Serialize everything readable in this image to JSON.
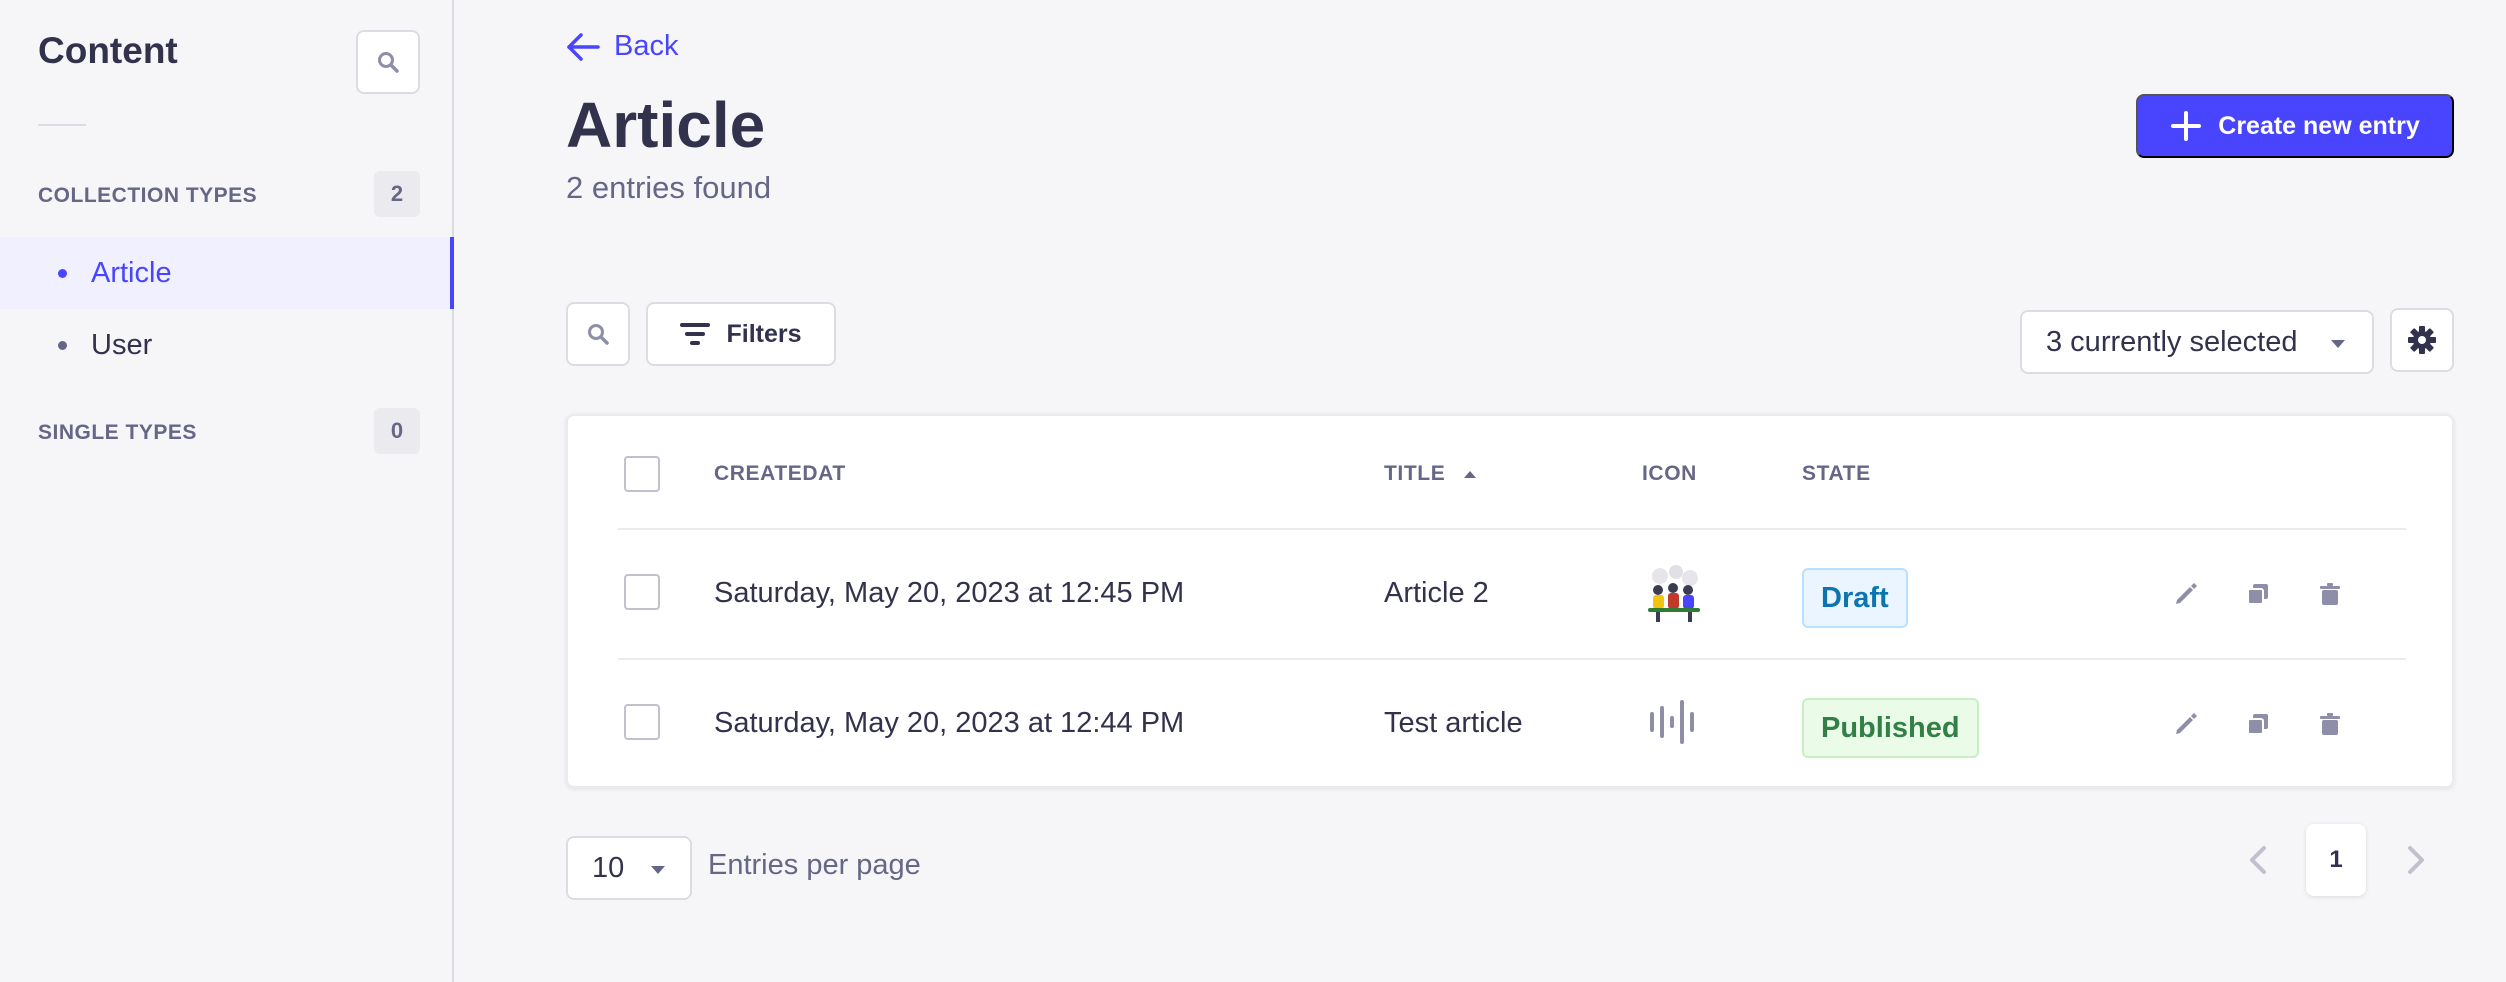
{
  "sidebar": {
    "title": "Content",
    "sections": [
      {
        "label": "COLLECTION TYPES",
        "count": "2"
      },
      {
        "label": "SINGLE TYPES",
        "count": "0"
      }
    ],
    "items": [
      {
        "label": "Article",
        "active": true
      },
      {
        "label": "User",
        "active": false
      }
    ]
  },
  "header": {
    "back_label": "Back",
    "title": "Article",
    "subtitle": "2 entries found",
    "create_label": "Create new entry"
  },
  "toolbar": {
    "filters_label": "Filters",
    "columns_selected": "3 currently selected"
  },
  "table": {
    "columns": [
      "CREATEDAT",
      "TITLE",
      "ICON",
      "STATE"
    ],
    "sort_column": "TITLE",
    "rows": [
      {
        "createdat": "Saturday, May 20, 2023 at 12:45 PM",
        "title": "Article 2",
        "icon": "illustration-thumbnail",
        "state": "Draft"
      },
      {
        "createdat": "Saturday, May 20, 2023 at 12:44 PM",
        "title": "Test article",
        "icon": "audio-file-icon",
        "state": "Published"
      }
    ]
  },
  "pagination": {
    "per_page": "10",
    "per_page_label": "Entries per page",
    "current_page": "1"
  },
  "colors": {
    "accent": "#4945ff",
    "draft": "#0c75af",
    "published": "#328048"
  }
}
